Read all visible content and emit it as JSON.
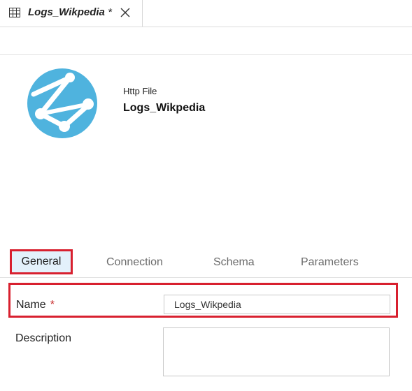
{
  "tab": {
    "title": "Logs_Wikpedia",
    "dirty_marker": "*"
  },
  "header": {
    "resource_type": "Http File",
    "resource_name": "Logs_Wikpedia"
  },
  "property_tabs": [
    {
      "label": "General",
      "selected": true
    },
    {
      "label": "Connection",
      "selected": false
    },
    {
      "label": "Schema",
      "selected": false
    },
    {
      "label": "Parameters",
      "selected": false
    }
  ],
  "form": {
    "name_label": "Name",
    "name_required": "*",
    "name_value": "Logs_Wikpedia",
    "description_label": "Description",
    "description_value": ""
  },
  "colors": {
    "highlight": "#d8202f",
    "selected_tab_bg": "#e3f1fb",
    "globe": "#4fb3de"
  },
  "icons": [
    "table-icon",
    "close-icon",
    "http-globe-icon"
  ]
}
